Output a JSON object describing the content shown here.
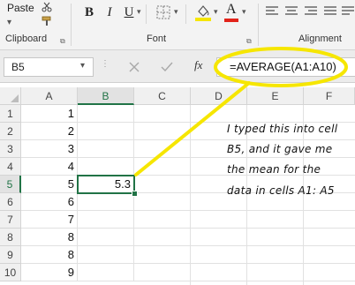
{
  "ribbon": {
    "paste_label": "Paste",
    "groups": {
      "clipboard": "Clipboard",
      "font": "Font",
      "alignment": "Alignment"
    },
    "format_buttons": {
      "bold": "B",
      "italic": "I",
      "underline": "U"
    },
    "font_color_letter": "A",
    "colors": {
      "fill": "#f6e600",
      "font_color": "#e2231a"
    }
  },
  "formula_bar": {
    "name_box": "B5",
    "fx": "fx",
    "formula": "=AVERAGE(A1:A10)"
  },
  "sheet": {
    "columns": [
      "A",
      "B",
      "C",
      "D",
      "E",
      "F"
    ],
    "rows": [
      "1",
      "2",
      "3",
      "4",
      "5",
      "6",
      "7",
      "8",
      "9",
      "10"
    ],
    "col_a_values": [
      "1",
      "2",
      "3",
      "4",
      "5",
      "6",
      "7",
      "8",
      "8",
      "9"
    ],
    "b5_value": "5.3",
    "selected_cell": "B5"
  },
  "annotation": {
    "lines": [
      "I typed this into cell",
      "B5, and it gave me",
      "the mean for the",
      "data in cells A1: A5"
    ],
    "highlight_color": "#f6e600"
  }
}
